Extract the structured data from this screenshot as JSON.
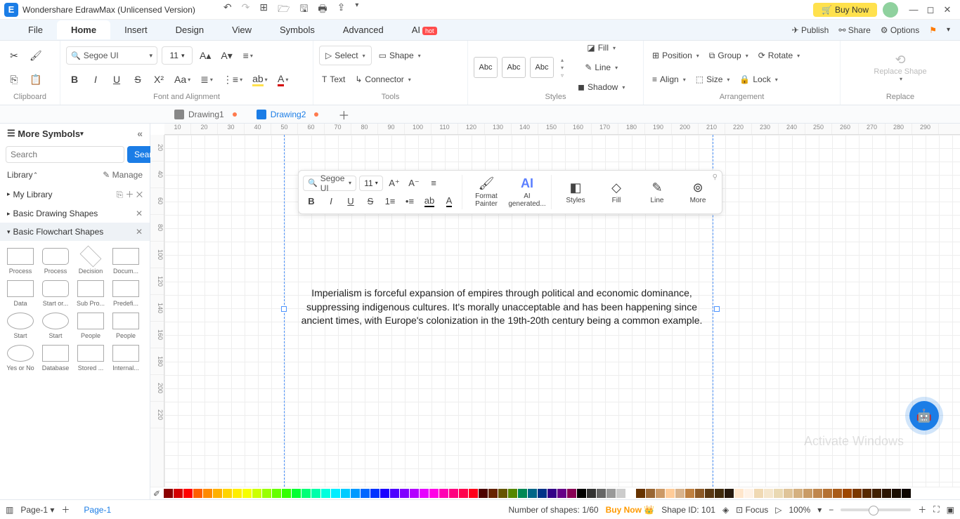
{
  "titlebar": {
    "app_title": "Wondershare EdrawMax (Unlicensed Version)",
    "buy_now": "Buy Now"
  },
  "menu": {
    "items": [
      "File",
      "Home",
      "Insert",
      "Design",
      "View",
      "Symbols",
      "Advanced",
      "AI"
    ],
    "active": "Home",
    "right": {
      "publish": "Publish",
      "share": "Share",
      "options": "Options"
    }
  },
  "ribbon": {
    "font": "Segoe UI",
    "size": "11",
    "groups": {
      "clipboard": "Clipboard",
      "font": "Font and Alignment",
      "tools": "Tools",
      "styles": "Styles",
      "arrangement": "Arrangement",
      "replace": "Replace"
    },
    "select": "Select",
    "shape": "Shape",
    "text": "Text",
    "connector": "Connector",
    "abc": "Abc",
    "fill": "Fill",
    "line": "Line",
    "shadow": "Shadow",
    "position": "Position",
    "align": "Align",
    "group": "Group",
    "size_btn": "Size",
    "rotate": "Rotate",
    "lock": "Lock",
    "replace_shape": "Replace Shape"
  },
  "tabs": {
    "t1": "Drawing1",
    "t2": "Drawing2"
  },
  "left": {
    "header": "More Symbols",
    "search_placeholder": "Search",
    "search_btn": "Search",
    "library": "Library",
    "manage": "Manage",
    "mylib": "My Library",
    "basic_drawing": "Basic Drawing Shapes",
    "basic_flowchart": "Basic Flowchart Shapes",
    "shapes": [
      [
        "Process",
        "Process",
        "Decision",
        "Docum..."
      ],
      [
        "Data",
        "Start or...",
        "Sub Pro...",
        "Predefi..."
      ],
      [
        "Start",
        "Start",
        "People",
        "People"
      ],
      [
        "Yes or No",
        "Database",
        "Stored ...",
        "Internal..."
      ]
    ]
  },
  "canvas": {
    "ruler_h": [
      "10",
      "20",
      "30",
      "40",
      "50",
      "60",
      "70",
      "80",
      "90",
      "100",
      "110",
      "120",
      "130",
      "140",
      "150",
      "160",
      "170",
      "180",
      "190",
      "200",
      "210",
      "220",
      "230",
      "240",
      "250",
      "260",
      "270",
      "280",
      "290"
    ],
    "ruler_v": [
      "20",
      "40",
      "60",
      "80",
      "100",
      "120",
      "140",
      "160",
      "180",
      "200",
      "220"
    ],
    "text": "Imperialism is forceful expansion of empires through political and economic dominance, suppressing indigenous cultures. It's morally unacceptable and has been happening since ancient times, with Europe's colonization in the 19th-20th century being a common example."
  },
  "float": {
    "font": "Segoe UI",
    "size": "11",
    "format_painter": "Format Painter",
    "ai": "AI generated...",
    "styles": "Styles",
    "fill": "Fill",
    "line": "Line",
    "more": "More"
  },
  "status": {
    "page_sel": "Page-1",
    "page_tab": "Page-1",
    "shapes": "Number of shapes: 1/60",
    "buy": "Buy Now",
    "shapeid": "Shape ID: 101",
    "focus": "Focus",
    "zoom": "100%"
  },
  "watermark": "Activate Windows",
  "colors": [
    "#8b0000",
    "#d40000",
    "#ff0000",
    "#ff5e00",
    "#ff8a00",
    "#ffb000",
    "#ffd400",
    "#ffee00",
    "#f6ff00",
    "#ccff00",
    "#99ff00",
    "#66ff00",
    "#33ff00",
    "#00ff33",
    "#00ff77",
    "#00ffaa",
    "#00ffdd",
    "#00eeff",
    "#00ccff",
    "#0099ff",
    "#0066ff",
    "#0033ff",
    "#1a00ff",
    "#4d00ff",
    "#8000ff",
    "#b300ff",
    "#e600ff",
    "#ff00e6",
    "#ff00b3",
    "#ff0080",
    "#ff004d",
    "#ff001a",
    "#4d0000",
    "#662200",
    "#665500",
    "#558800",
    "#008855",
    "#006688",
    "#003388",
    "#330088",
    "#660088",
    "#880055",
    "#000000",
    "#333333",
    "#666666",
    "#999999",
    "#cccccc",
    "#ffffff",
    "#663300",
    "#996633",
    "#cc9966",
    "#ffcc99",
    "#d9b38c",
    "#bf8040",
    "#8c5926",
    "#593813",
    "#402b0d",
    "#26190d",
    "#ffe6cc",
    "#fff2e6",
    "#f0d9b3",
    "#f5e6cc",
    "#ead9b3",
    "#dfc499",
    "#d4b080",
    "#c99b66",
    "#bf864d",
    "#b47133",
    "#a95c1a",
    "#9e4700",
    "#7a3800",
    "#562900",
    "#401f00",
    "#2b1400",
    "#1a0d00",
    "#0d0600",
    "#ffffff"
  ]
}
